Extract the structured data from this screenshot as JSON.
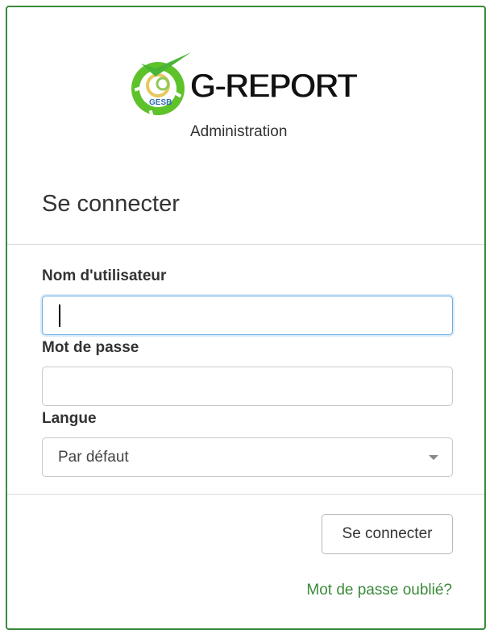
{
  "brand": {
    "logo_text": "G-REPORT",
    "logo_badge": "GESB",
    "subtitle": "Administration",
    "accent_color": "#3a8a3a",
    "logo_green": "#5ec22a"
  },
  "login": {
    "title": "Se connecter",
    "username": {
      "label": "Nom d'utilisateur",
      "value": "",
      "focused": true
    },
    "password": {
      "label": "Mot de passe",
      "value": ""
    },
    "language": {
      "label": "Langue",
      "selected": "Par défaut"
    },
    "submit_label": "Se connecter",
    "forgot_label": "Mot de passe oublié?"
  },
  "icons": {
    "logo": "gesb-logo-icon",
    "dropdown": "chevron-down-icon"
  }
}
